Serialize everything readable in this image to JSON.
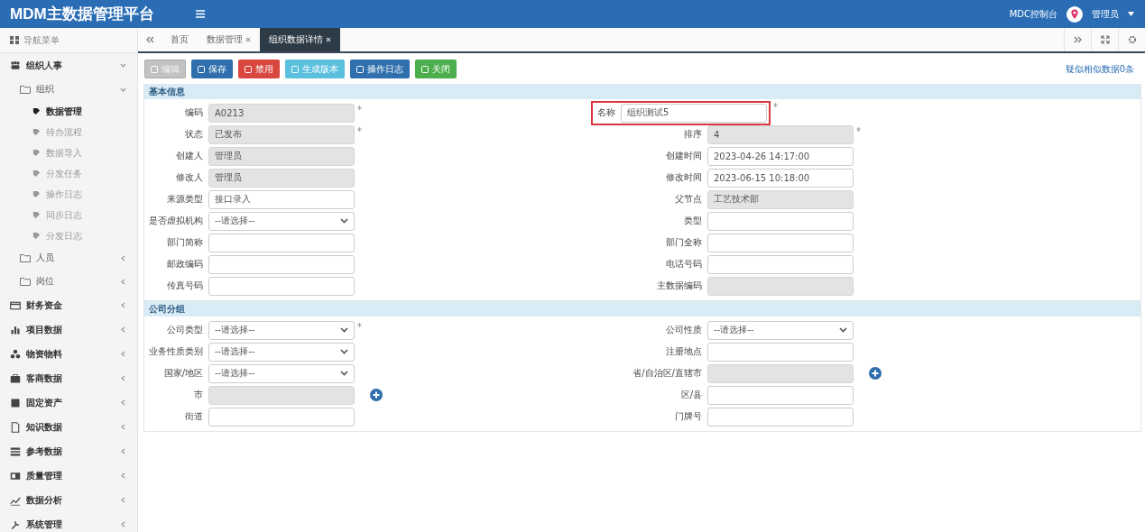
{
  "header": {
    "title": "MDM主数据管理平台",
    "console_link": "MDC控制台",
    "user": "管理员"
  },
  "sidebar": {
    "heading": "导航菜单",
    "items": [
      {
        "label": "组织人事",
        "expanded": true,
        "children": [
          {
            "label": "组织",
            "expanded": true,
            "children": [
              {
                "label": "数据管理",
                "selected": true
              },
              {
                "label": "待办流程",
                "selected": false
              },
              {
                "label": "数据导入",
                "selected": false
              },
              {
                "label": "分发任务",
                "selected": false
              },
              {
                "label": "操作日志",
                "selected": false
              },
              {
                "label": "同步日志",
                "selected": false
              },
              {
                "label": "分发日志",
                "selected": false
              }
            ]
          },
          {
            "label": "人员",
            "expanded": false
          },
          {
            "label": "岗位",
            "expanded": false
          }
        ]
      },
      {
        "label": "财务资金",
        "expanded": false
      },
      {
        "label": "项目数据",
        "expanded": false
      },
      {
        "label": "物资物料",
        "expanded": false
      },
      {
        "label": "客商数据",
        "expanded": false
      },
      {
        "label": "固定资产",
        "expanded": false
      },
      {
        "label": "知识数据",
        "expanded": false
      },
      {
        "label": "参考数据",
        "expanded": false
      },
      {
        "label": "质量管理",
        "expanded": false
      },
      {
        "label": "数据分析",
        "expanded": false
      },
      {
        "label": "系统管理",
        "expanded": false
      }
    ]
  },
  "tabs": [
    {
      "label": "首页",
      "closable": false,
      "selected": false
    },
    {
      "label": "数据管理",
      "closable": true,
      "selected": false
    },
    {
      "label": "组织数据详情",
      "closable": true,
      "selected": true
    }
  ],
  "toolbar": {
    "buttons": [
      {
        "label": "编辑",
        "color": "#c2c2c2",
        "disabled": true
      },
      {
        "label": "保存",
        "color": "#2f6fad",
        "disabled": false
      },
      {
        "label": "禁用",
        "color": "#d9473f",
        "disabled": false
      },
      {
        "label": "生成版本",
        "color": "#5bc0de",
        "disabled": false
      },
      {
        "label": "操作日志",
        "color": "#2f6fad",
        "disabled": false
      },
      {
        "label": "关闭",
        "color": "#4cae4c",
        "disabled": false
      }
    ],
    "similar_link": "疑似相似数据0条"
  },
  "sections": [
    {
      "title": "基本信息",
      "rows": [
        {
          "left": {
            "label": "编码",
            "kind": "text",
            "value": "A0213",
            "disabled": true,
            "required": true
          },
          "right": {
            "label": "名称",
            "kind": "text",
            "value": "组织测试5",
            "disabled": false,
            "required": true,
            "highlighted": true
          }
        },
        {
          "left": {
            "label": "状态",
            "kind": "text",
            "value": "已发布",
            "disabled": true,
            "required": true
          },
          "right": {
            "label": "排序",
            "kind": "text",
            "value": "4",
            "disabled": true,
            "required": true
          }
        },
        {
          "left": {
            "label": "创建人",
            "kind": "text",
            "value": "管理员",
            "disabled": true
          },
          "right": {
            "label": "创建时间",
            "kind": "text",
            "value": "2023-04-26 14:17:00",
            "disabled": false
          }
        },
        {
          "left": {
            "label": "修改人",
            "kind": "text",
            "value": "管理员",
            "disabled": true
          },
          "right": {
            "label": "修改时间",
            "kind": "text",
            "value": "2023-06-15 10:18:00",
            "disabled": false
          }
        },
        {
          "left": {
            "label": "来源类型",
            "kind": "text",
            "value": "接口录入",
            "disabled": false
          },
          "right": {
            "label": "父节点",
            "kind": "text",
            "value": "工艺技术部",
            "disabled": true
          }
        },
        {
          "left": {
            "label": "是否虚拟机构",
            "kind": "select",
            "value": "--请选择--",
            "disabled": false
          },
          "right": {
            "label": "类型",
            "kind": "text",
            "disabled": false
          }
        },
        {
          "left": {
            "label": "部门简称",
            "kind": "text",
            "disabled": false
          },
          "right": {
            "label": "部门全称",
            "kind": "text",
            "disabled": false
          }
        },
        {
          "left": {
            "label": "邮政编码",
            "kind": "text",
            "disabled": false
          },
          "right": {
            "label": "电话号码",
            "kind": "text",
            "disabled": false
          }
        },
        {
          "left": {
            "label": "传真号码",
            "kind": "text",
            "disabled": false
          },
          "right": {
            "label": "主数据编码",
            "kind": "text",
            "disabled": true
          }
        }
      ]
    },
    {
      "title": "公司分组",
      "rows": [
        {
          "left": {
            "label": "公司类型",
            "kind": "select",
            "value": "--请选择--",
            "disabled": false,
            "required": true
          },
          "right": {
            "label": "公司性质",
            "kind": "select",
            "value": "--请选择--",
            "disabled": false
          }
        },
        {
          "left": {
            "label": "业务性质类别",
            "kind": "select",
            "value": "--请选择--",
            "disabled": false
          },
          "right": {
            "label": "注册地点",
            "kind": "text",
            "disabled": false
          }
        },
        {
          "left": {
            "label": "国家/地区",
            "kind": "select",
            "value": "--请选择--",
            "disabled": false
          },
          "right": {
            "label": "省/自治区/直辖市",
            "kind": "text",
            "disabled": true,
            "add_button": true
          }
        },
        {
          "left": {
            "label": "市",
            "kind": "text",
            "disabled": true,
            "add_button": true
          },
          "right": {
            "label": "区/县",
            "kind": "text",
            "disabled": false
          }
        },
        {
          "left": {
            "label": "街道",
            "kind": "text",
            "disabled": false
          },
          "right": {
            "label": "门牌号",
            "kind": "text",
            "disabled": false
          }
        }
      ]
    }
  ]
}
